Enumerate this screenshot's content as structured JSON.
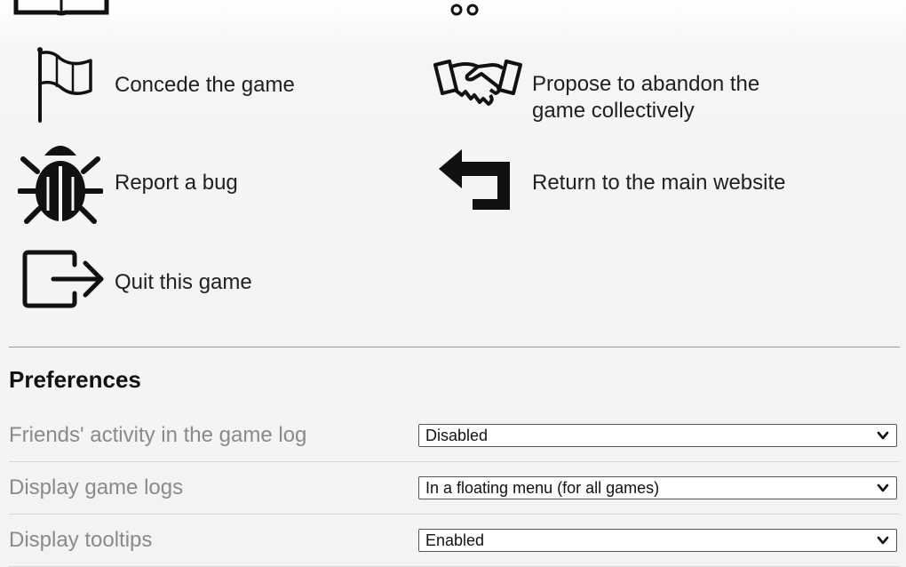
{
  "actions": {
    "concede": "Concede the game",
    "abandon": "Propose to abandon the game collectively",
    "report_bug": "Report a bug",
    "return_site": "Return to the main website",
    "quit": "Quit this game"
  },
  "preferences": {
    "title": "Preferences",
    "rows": [
      {
        "label": "Friends' activity in the game log",
        "value": "Disabled"
      },
      {
        "label": "Display game logs",
        "value": "In a floating menu (for all games)"
      },
      {
        "label": "Display tooltips",
        "value": "Enabled"
      }
    ]
  },
  "icons": {
    "top_left": "book-icon",
    "top_right": "cart-icon",
    "concede": "white-flag-icon",
    "abandon": "handshake-icon",
    "report_bug": "bug-icon",
    "return_site": "return-arrow-icon",
    "quit": "exit-icon",
    "dropdown": "chevron-down-icon"
  }
}
